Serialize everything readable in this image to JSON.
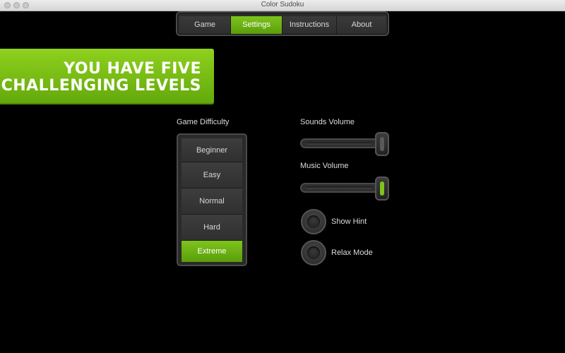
{
  "window": {
    "title": "Color Sudoku"
  },
  "nav": {
    "tabs": [
      {
        "label": "Game",
        "active": false
      },
      {
        "label": "Settings",
        "active": true
      },
      {
        "label": "Instructions",
        "active": false
      },
      {
        "label": "About",
        "active": false
      }
    ]
  },
  "banner": {
    "line1": "YOU HAVE FIVE",
    "line2": "CHALLENGING LEVELS"
  },
  "difficulty": {
    "label": "Game Difficulty",
    "options": [
      "Beginner",
      "Easy",
      "Normal",
      "Hard",
      "Extreme"
    ],
    "selected": "Extreme"
  },
  "sounds": {
    "label": "Sounds Volume",
    "level": 1.0
  },
  "music": {
    "label": "Music Volume",
    "level": 1.0
  },
  "show_hint": {
    "label": "Show Hint",
    "on": false
  },
  "relax_mode": {
    "label": "Relax Mode",
    "on": false
  },
  "colors": {
    "accent": "#6bb514",
    "background": "#000000"
  }
}
